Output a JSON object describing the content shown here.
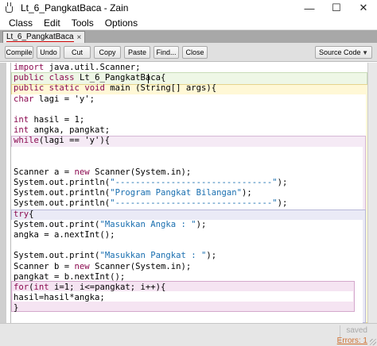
{
  "window": {
    "title": "Lt_6_PangkatBaca - Zain",
    "minimize": "—",
    "maximize": "☐",
    "close": "✕"
  },
  "menu": [
    "Class",
    "Edit",
    "Tools",
    "Options"
  ],
  "tab": {
    "label": "Lt_6_PangkatBaca",
    "close": "×"
  },
  "toolbar": {
    "buttons": [
      "Compile",
      "Undo",
      "Cut",
      "Copy",
      "Paste",
      "Find...",
      "Close"
    ],
    "view_selected": "Source Code",
    "view_chevron": "▼"
  },
  "code": {
    "lines": [
      "import java.util.Scanner;",
      "public class Lt_6_PangkatBaca{",
      "public static void main (String[] args){",
      "char lagi = 'y';",
      "",
      "int hasil = 1;",
      "int angka, pangkat;",
      "while(lagi == 'y'){",
      "",
      "",
      "Scanner a = new Scanner(System.in);",
      "System.out.println(\"-------------------------------\");",
      "System.out.println(\"Program Pangkat Bilangan\");",
      "System.out.println(\"-------------------------------\");",
      "try{",
      "System.out.print(\"Masukkan Angka : \");",
      "angka = a.nextInt();",
      "",
      "System.out.print(\"Masukkan Pangkat : \");",
      "Scanner b = new Scanner(System.in);",
      "pangkat = b.nextInt();",
      "for(int i=1; i<=pangkat; i++){",
      "hasil=hasil*angka;",
      "}"
    ]
  },
  "status": {
    "saved": "saved",
    "errors": "Errors: 1"
  },
  "colors": {
    "keyword": "#8b0a50",
    "string": "#1a6fb0",
    "class_scope": "#eef7e6",
    "method_scope": "#fff8d6",
    "loop_scope": "#f5eaf5",
    "try_scope": "#eaeaf6"
  }
}
